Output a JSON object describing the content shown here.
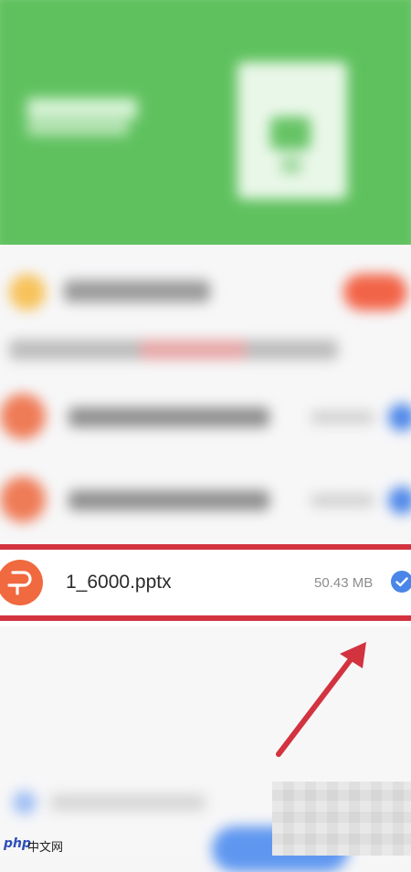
{
  "file": {
    "name": "1_6000.pptx",
    "size": "50.43 MB",
    "icon_letter": "P",
    "selected": true
  },
  "watermark": {
    "logo": "php",
    "site": "中文网"
  },
  "colors": {
    "header_green": "#5fc15e",
    "highlight_red": "#d2333f",
    "pptx_orange": "#f0693f",
    "check_blue": "#4a86e8"
  },
  "icons": [
    "pptx-file-icon",
    "checkmark-icon",
    "annotation-arrow-icon"
  ]
}
